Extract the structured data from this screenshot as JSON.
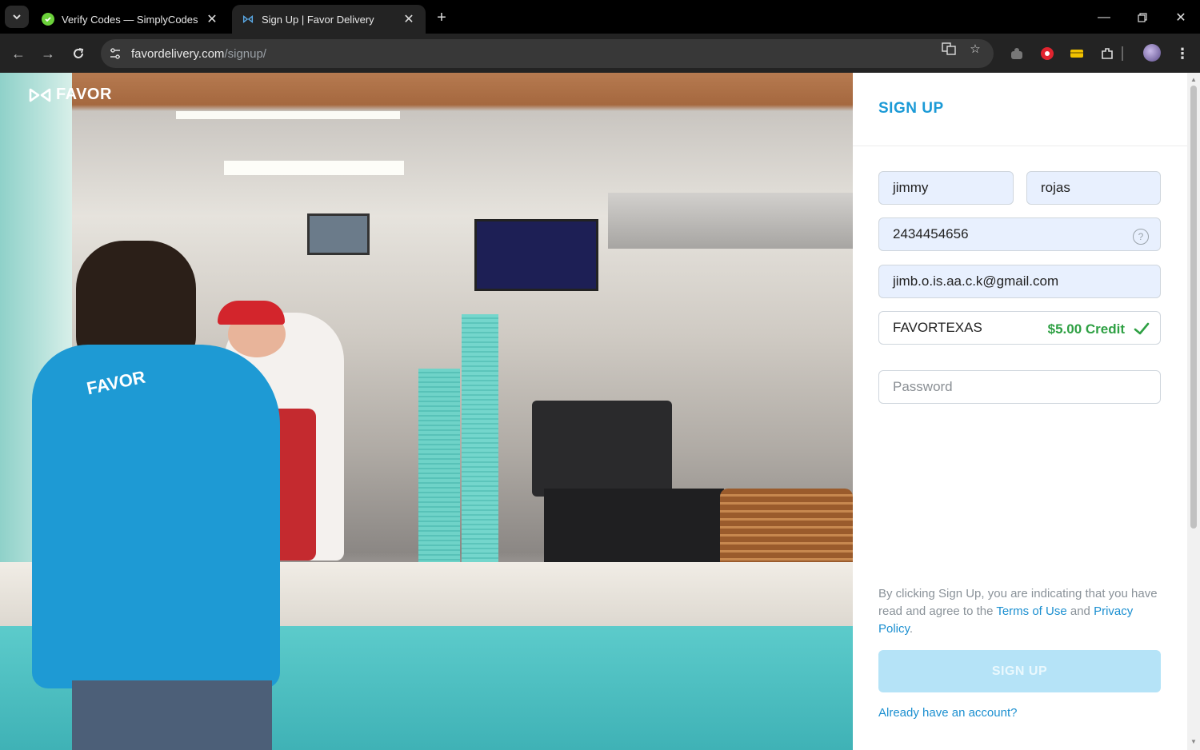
{
  "browser": {
    "tabs": [
      {
        "title": "Verify Codes — SimplyCodes",
        "active": false,
        "favicon": "simplycodes-icon"
      },
      {
        "title": "Sign Up | Favor Delivery",
        "active": true,
        "favicon": "favor-icon"
      }
    ],
    "url_host": "favordelivery.com",
    "url_path": "/signup/"
  },
  "hero": {
    "logo_text": "FAVOR"
  },
  "form": {
    "title": "SIGN UP",
    "first_name": "jimmy",
    "last_name": "rojas",
    "phone": "2434454656",
    "email": "jimb.o.is.aa.c.k@gmail.com",
    "promo_code": "FAVORTEXAS",
    "promo_credit": "$5.00 Credit",
    "password_placeholder": "Password",
    "legal_prefix": "By clicking Sign Up, you are indicating that you have read and agree to the ",
    "terms_label": "Terms of Use",
    "legal_and": " and ",
    "privacy_label": "Privacy Policy",
    "legal_suffix": ".",
    "submit_label": "SIGN UP",
    "login_link": "Already have an account?"
  },
  "colors": {
    "accent": "#1b9ad6",
    "credit_green": "#2ea043",
    "button_disabled": "#b5e3f7"
  }
}
